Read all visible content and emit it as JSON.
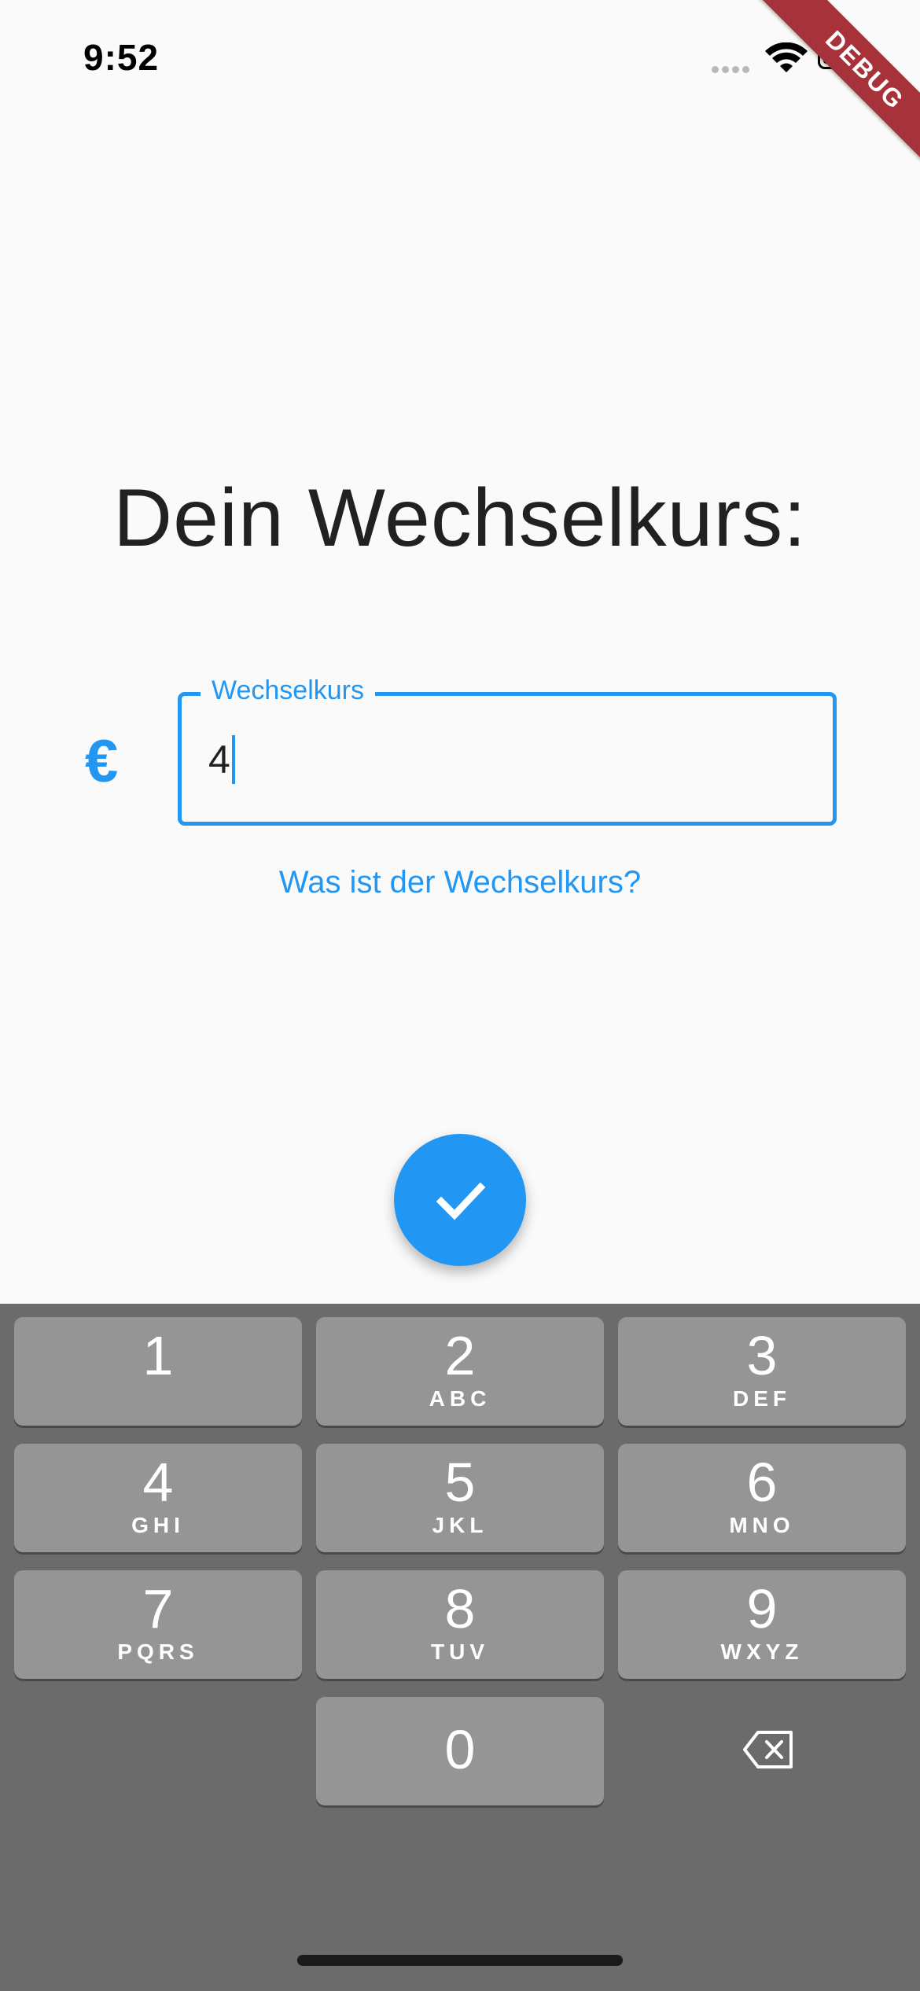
{
  "status_bar": {
    "time": "9:52"
  },
  "debug_banner": "DEBUG",
  "title": "Dein Wechselkurs:",
  "rate_field": {
    "currency_symbol": "€",
    "label": "Wechselkurs",
    "value": "4"
  },
  "help_link": "Was ist der Wechselkurs?",
  "keypad": {
    "k1": {
      "num": "1",
      "letters": ""
    },
    "k2": {
      "num": "2",
      "letters": "ABC"
    },
    "k3": {
      "num": "3",
      "letters": "DEF"
    },
    "k4": {
      "num": "4",
      "letters": "GHI"
    },
    "k5": {
      "num": "5",
      "letters": "JKL"
    },
    "k6": {
      "num": "6",
      "letters": "MNO"
    },
    "k7": {
      "num": "7",
      "letters": "PQRS"
    },
    "k8": {
      "num": "8",
      "letters": "TUV"
    },
    "k9": {
      "num": "9",
      "letters": "WXYZ"
    },
    "k0": {
      "num": "0",
      "letters": ""
    }
  },
  "colors": {
    "accent": "#2196f3",
    "keyboard_bg": "#6b6b6b",
    "key_bg": "#959595",
    "debug": "#a8323a"
  },
  "icons": {
    "fab": "check-icon",
    "delete": "backspace-icon",
    "currency": "euro-icon"
  }
}
